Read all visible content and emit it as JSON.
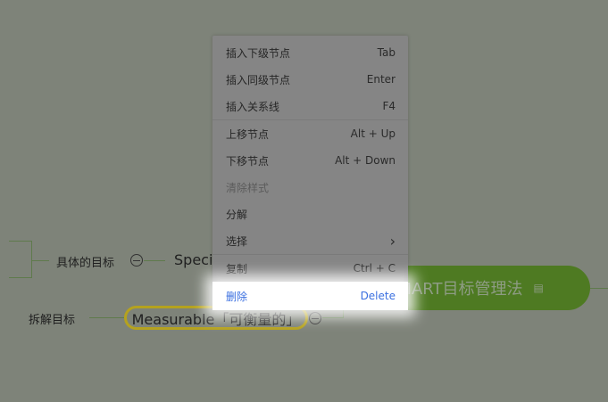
{
  "mindmap": {
    "central": "SMART目标管理法",
    "central_color": "#4e7a22",
    "branch_specific": "具体的目标",
    "specific_node": "Speci",
    "branch_measurable": "拆解目标",
    "measurable_node": "Measurable「可衡量的」"
  },
  "menu": {
    "items": [
      {
        "label": "插入下级节点",
        "shortcut": "Tab"
      },
      {
        "label": "插入同级节点",
        "shortcut": "Enter"
      },
      {
        "label": "插入关系线",
        "shortcut": "F4"
      },
      {
        "label": "上移节点",
        "shortcut": "Alt + Up"
      },
      {
        "label": "下移节点",
        "shortcut": "Alt + Down"
      },
      {
        "label": "清除样式",
        "shortcut": ""
      },
      {
        "label": "分解",
        "shortcut": ""
      },
      {
        "label": "选择",
        "shortcut": "›"
      },
      {
        "label": "复制",
        "shortcut": "Ctrl + C"
      },
      {
        "label": "删除",
        "shortcut": "Delete"
      }
    ]
  }
}
